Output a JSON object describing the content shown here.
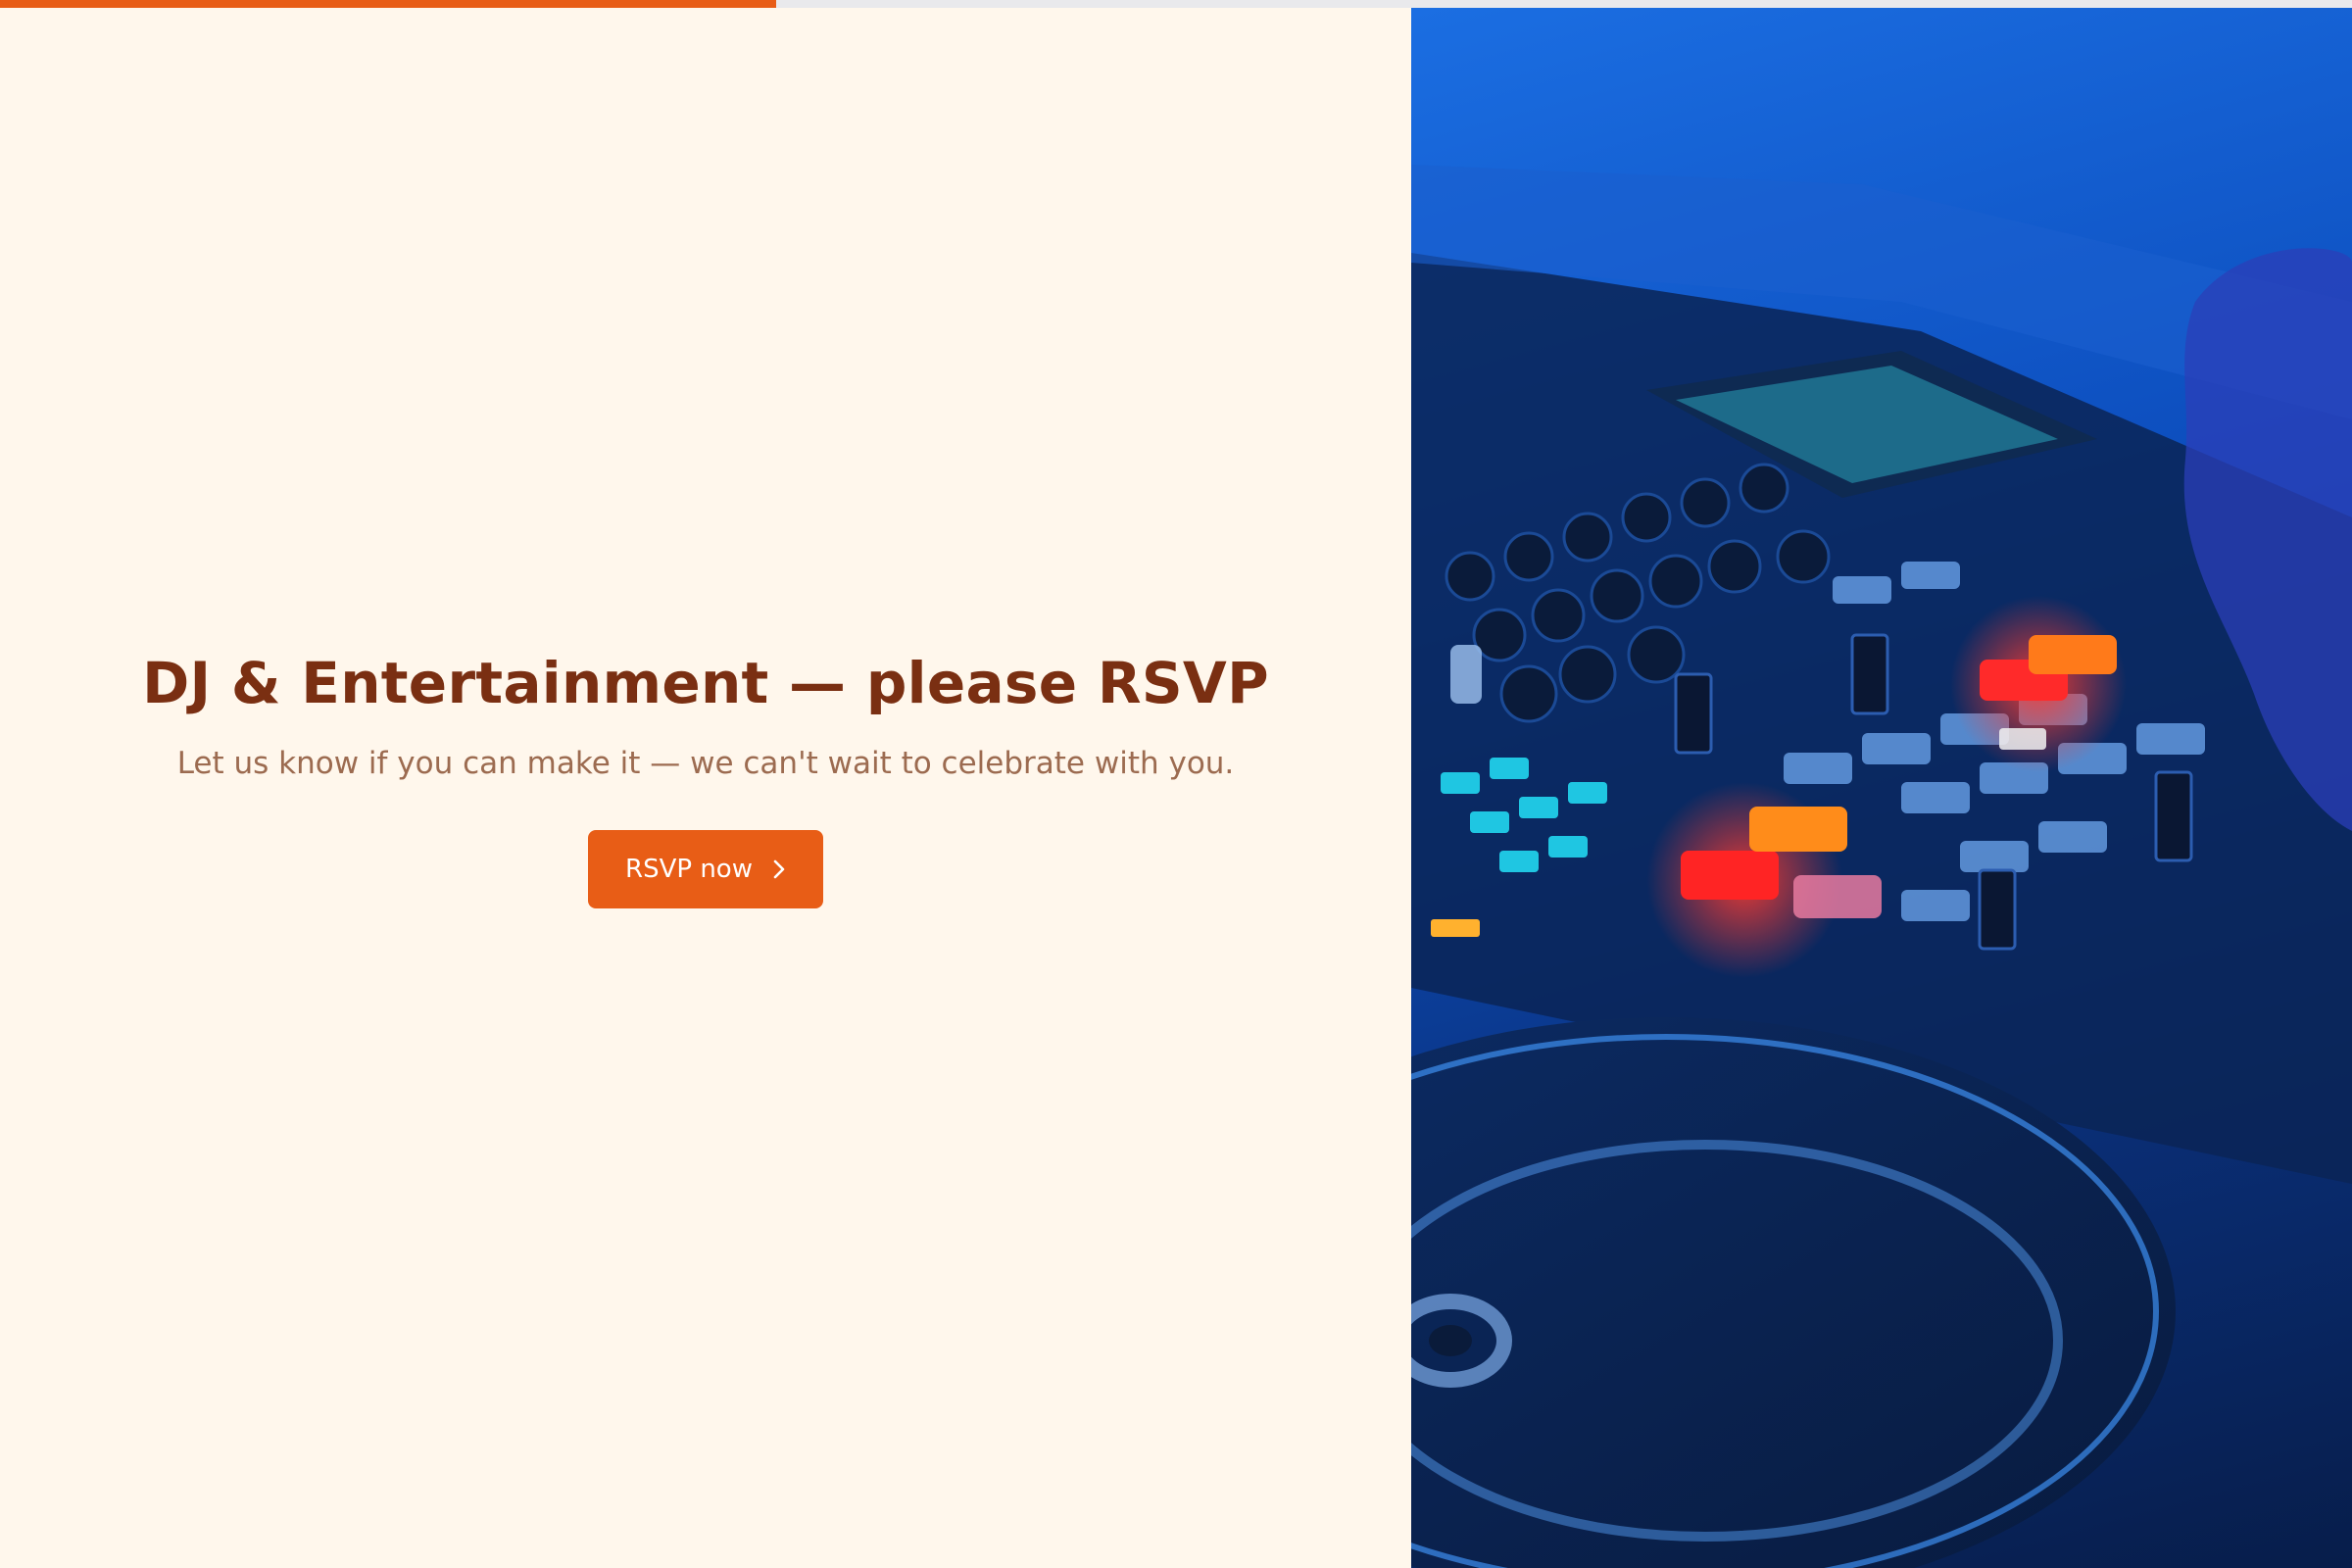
{
  "progress": {
    "percent": 33
  },
  "hero": {
    "title": "DJ & Entertainment — please RSVP",
    "subtitle": "Let us know if you can make it — we can't wait to celebrate with you.",
    "button_label": "RSVP now",
    "button_icon": "chevron-right-icon"
  },
  "image": {
    "subject": "dj-mixer-photo"
  },
  "colors": {
    "accent": "#e85d16",
    "heading": "#7a2f12",
    "body_text": "#9c6b50",
    "background": "#fff7ec",
    "image_blue": "#1066e0"
  }
}
